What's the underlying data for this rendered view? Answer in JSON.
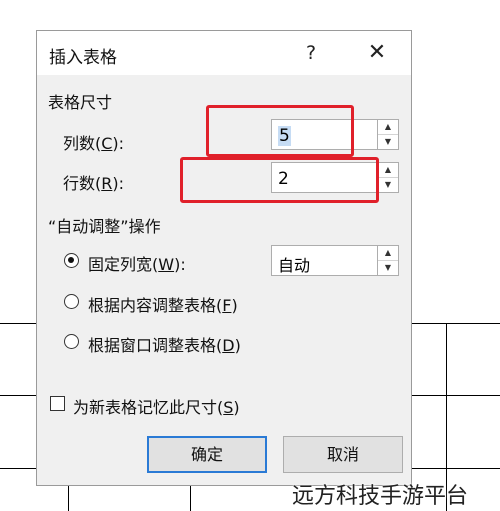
{
  "dialog": {
    "title": "插入表格",
    "help_glyph": "?",
    "close_glyph": "✕",
    "table_size": {
      "section_label": "表格尺寸",
      "columns_label_pre": "列数(",
      "columns_label_key": "C",
      "columns_label_post": "):",
      "columns_value": "5",
      "rows_label_pre": "行数(",
      "rows_label_key": "R",
      "rows_label_post": "):",
      "rows_value": "2"
    },
    "autofit": {
      "section_label": "“自动调整”操作",
      "fixed_width_pre": "固定列宽(",
      "fixed_width_key": "W",
      "fixed_width_post": "):",
      "fixed_width_value": "自动",
      "fit_content_pre": "根据内容调整表格(",
      "fit_content_key": "F",
      "fit_content_post": ")",
      "fit_window_pre": "根据窗口调整表格(",
      "fit_window_key": "D",
      "fit_window_post": ")",
      "selected": "fixed_width"
    },
    "remember": {
      "label_pre": "为新表格记忆此尺寸(",
      "label_key": "S",
      "label_post": ")",
      "checked": false
    },
    "buttons": {
      "ok": "确定",
      "cancel": "取消"
    }
  },
  "watermark": "远方科技手游平台",
  "colors": {
    "highlight_box": "#e0202a",
    "default_button_border": "#2a7ad5",
    "dialog_bg": "#f0f0f0"
  }
}
